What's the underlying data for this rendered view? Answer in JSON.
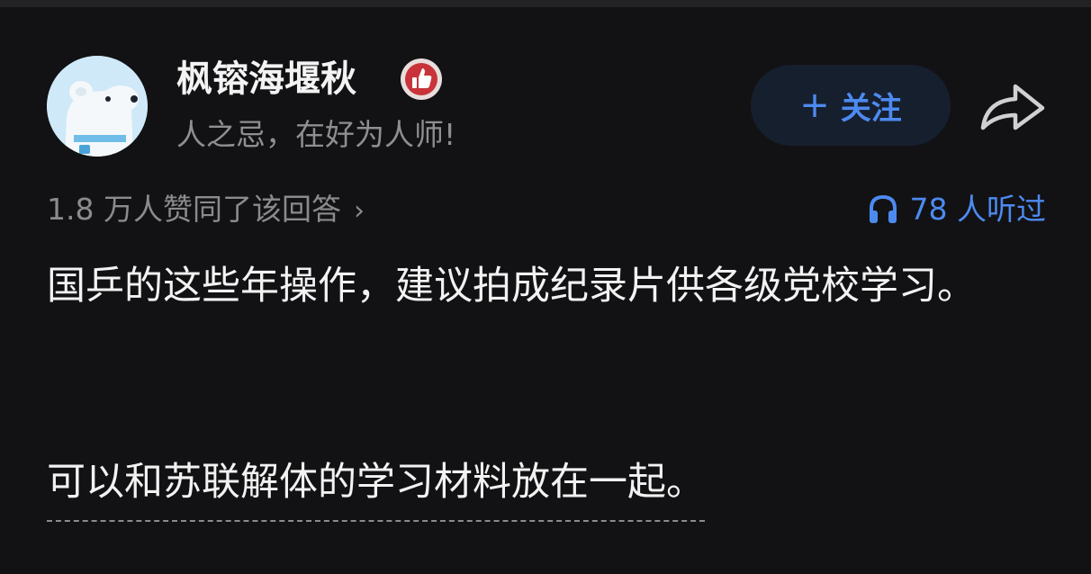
{
  "author": {
    "name": "枫镕海堰秋",
    "signature": "人之忌，在好为人师!",
    "avatar_icon": "polar-bear-avatar",
    "badge_icon": "thumbs-up-badge-icon"
  },
  "actions": {
    "follow_plus": "+",
    "follow_label": "关注",
    "share_icon": "share-arrow-icon"
  },
  "stats": {
    "likes_text": "1.8 万人赞同了该回答",
    "likes_chevron": "›",
    "listeners_text": "78 人听过"
  },
  "content": {
    "paragraph_1": "国乒的这些年操作，建议拍成纪录片供各级党校学习。",
    "paragraph_2": "可以和苏联解体的学习材料放在一起。"
  },
  "colors": {
    "background": "#121214",
    "accent": "#4d8af0",
    "primary_text": "#f2f2f2",
    "secondary_text": "#8a8a8f",
    "badge_red": "#c8343a"
  }
}
